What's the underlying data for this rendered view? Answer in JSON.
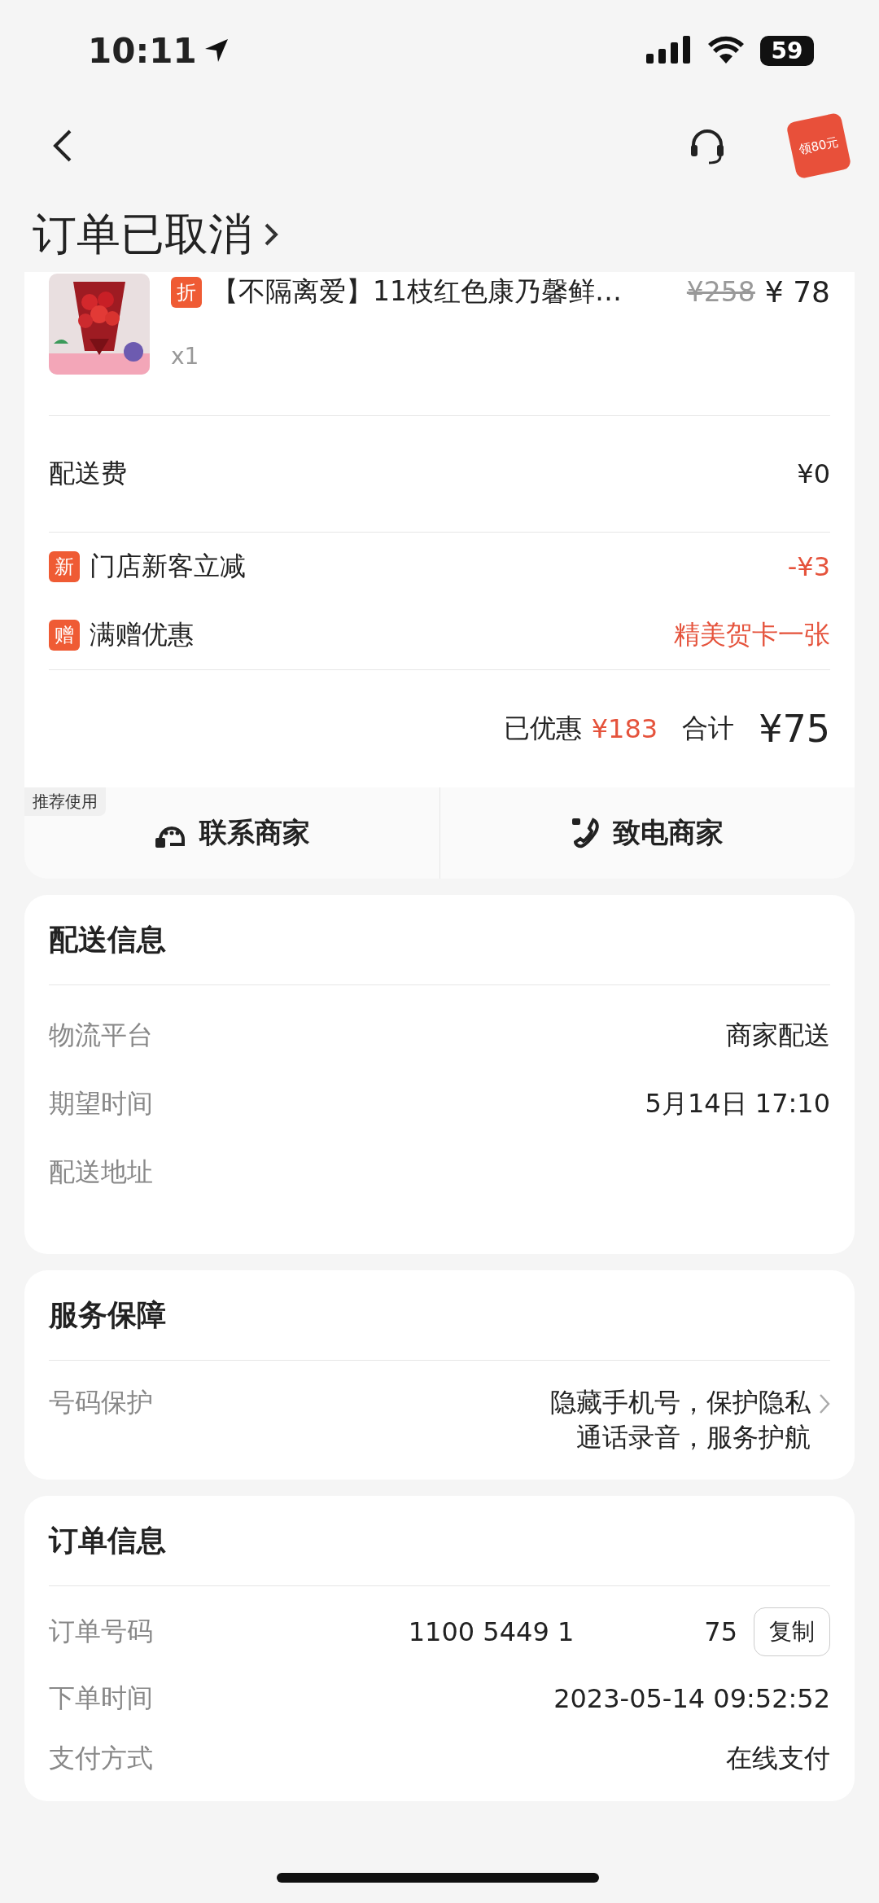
{
  "status_bar": {
    "time": "10:11",
    "battery": "59"
  },
  "header": {
    "promo": "领80元",
    "title": "订单已取消"
  },
  "product": {
    "badge": "折",
    "name": "【不隔离爱】11枝红色康乃馨鲜…",
    "original_price": "¥258",
    "price": "¥ 78",
    "quantity": "x1"
  },
  "fee": {
    "label": "配送费",
    "value": "¥0"
  },
  "discounts": [
    {
      "badge": "新",
      "label": "门店新客立减",
      "value": "-¥3"
    },
    {
      "badge": "赠",
      "label": "满赠优惠",
      "value": "精美贺卡一张"
    }
  ],
  "summary": {
    "saved_label": "已优惠",
    "saved": "¥183",
    "total_label": "合计",
    "total": "¥75"
  },
  "actions": {
    "tag": "推荐使用",
    "buttons": [
      {
        "kind": "chat",
        "label": "联系商家"
      },
      {
        "kind": "phone",
        "label": "致电商家"
      }
    ]
  },
  "delivery": {
    "title": "配送信息",
    "rows": [
      {
        "label": "物流平台",
        "value": "商家配送"
      },
      {
        "label": "期望时间",
        "value": "5月14日 17:10"
      },
      {
        "label": "配送地址"
      }
    ]
  },
  "service": {
    "title": "服务保障",
    "label": "号码保护",
    "lines": [
      "隐藏手机号，保护隐私",
      "通话录音，服务护航"
    ]
  },
  "order": {
    "title": "订单信息",
    "number_label": "订单号码",
    "number_parts": [
      "1100 5449 1",
      "75"
    ],
    "copy": "复制",
    "rows": [
      {
        "label": "下单时间",
        "value": "2023-05-14 09:52:52"
      },
      {
        "label": "支付方式",
        "value": "在线支付"
      }
    ]
  }
}
